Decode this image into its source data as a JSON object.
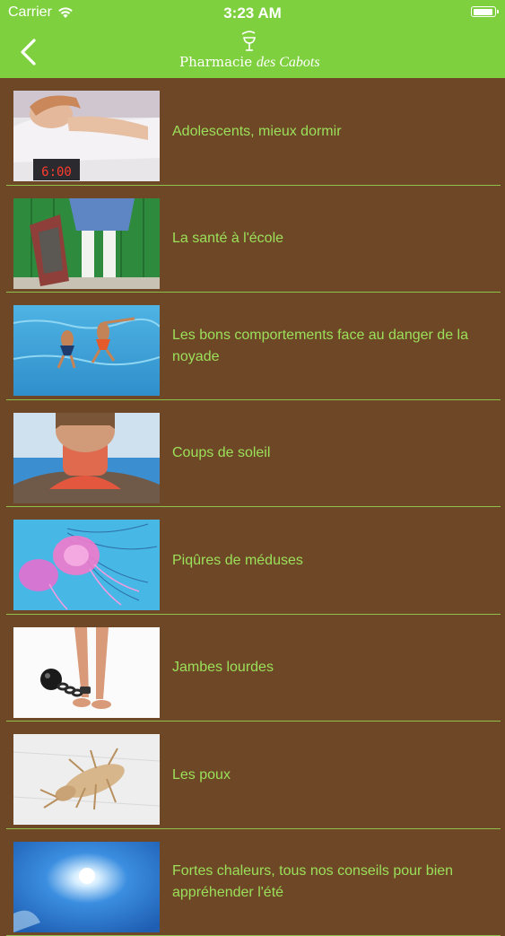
{
  "status_bar": {
    "carrier": "Carrier",
    "time": "3:23 AM"
  },
  "header": {
    "logo_text_main": "Pharmacie",
    "logo_text_script": "des Cabots",
    "back_icon": "chevron-left-icon"
  },
  "colors": {
    "header_bg": "#7fd03f",
    "list_bg": "#6e4826",
    "label_text": "#9be05a",
    "separator": "#8fc24a"
  },
  "articles": [
    {
      "title": "Adolescents, mieux dormir",
      "thumbnail": "sleeping-teen-image"
    },
    {
      "title": "La santé à l'école",
      "thumbnail": "school-kids-image"
    },
    {
      "title": "Les bons comportements face au danger de la noyade",
      "thumbnail": "swimming-kids-image"
    },
    {
      "title": "Coups de soleil",
      "thumbnail": "sunburn-neck-image"
    },
    {
      "title": "Piqûres de méduses",
      "thumbnail": "jellyfish-image"
    },
    {
      "title": "Jambes lourdes",
      "thumbnail": "heavy-legs-image"
    },
    {
      "title": "Les poux",
      "thumbnail": "louse-image"
    },
    {
      "title": "Fortes chaleurs, tous nos conseils pour bien appréhender l'été",
      "thumbnail": "sun-sky-image"
    }
  ]
}
